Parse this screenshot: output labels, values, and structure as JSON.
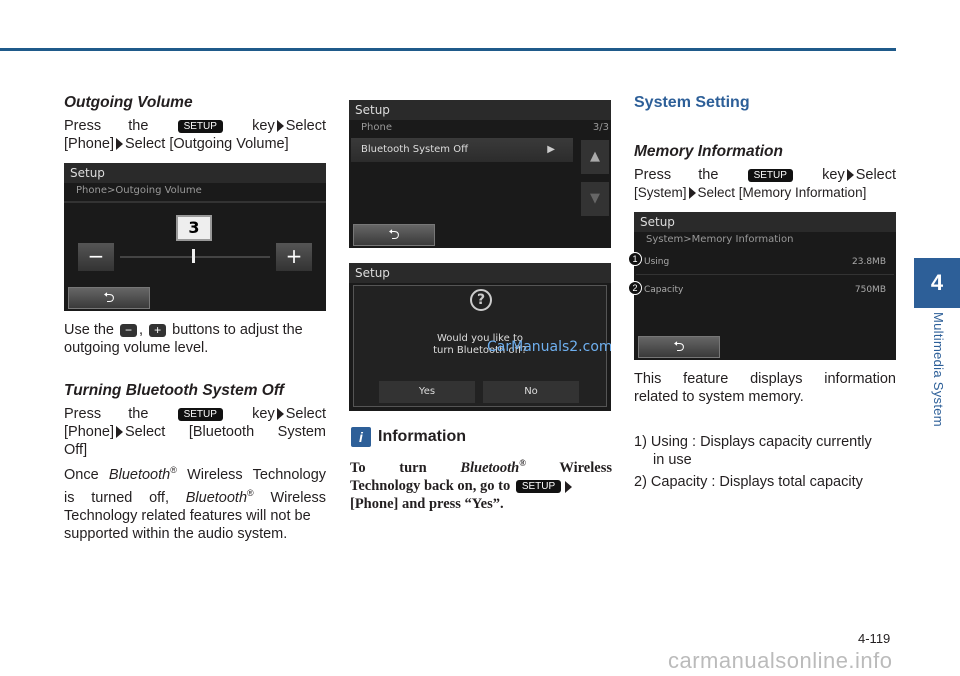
{
  "side": {
    "chapter": "4",
    "label": "Multimedia System"
  },
  "footer": {
    "page": "4-119",
    "watermark": "carmanualsonline.info"
  },
  "col1": {
    "h_outgoing": "Outgoing Volume",
    "press": "Press the",
    "setup": "SETUP",
    "key_select": "key",
    "select": "Select",
    "outgoing_path_a": "[Phone]",
    "outgoing_path_b": "Select [Outgoing Volume]",
    "shot1": {
      "title": "Setup",
      "sub": "Phone>Outgoing Volume",
      "value": "3",
      "minus": "−",
      "plus": "+",
      "back": "⮌"
    },
    "use_a": "Use the",
    "use_comma": ",",
    "use_b": "buttons to adjust the",
    "use_c": "outgoing volume level.",
    "h_bt": "Turning Bluetooth System Off",
    "bt_path_a": "[Phone]",
    "bt_path_b": "Select [Bluetooth System",
    "bt_path_c": "Off]",
    "once_a": "Once",
    "once_bt": "Bluetooth",
    "reg": "®",
    "once_b": "Wireless Technology",
    "once_c": "is turned off,",
    "once_d": "Wireless",
    "once_e": "Technology related features will not be",
    "once_f": "supported within the audio system."
  },
  "col2": {
    "shot2": {
      "title": "Setup",
      "sub": "Phone",
      "page": "3/3",
      "item": "Bluetooth System Off"
    },
    "shot3": {
      "title": "Setup",
      "q": "?",
      "msg1": "Would you like to",
      "msg2": "turn Bluetooth off?",
      "yes": "Yes",
      "no": "No",
      "wm": "CarManuals2.com"
    },
    "info_icon": "i",
    "info_title": "Information",
    "info_a": "To turn",
    "info_bt": "Bluetooth",
    "info_reg": "®",
    "info_b": "Wireless",
    "info_c": "Technology back on, go to",
    "info_d": "[Phone] and press “Yes”.",
    "setup": "SETUP"
  },
  "col3": {
    "h_sys": "System Setting",
    "h_mem": "Memory Information",
    "press": "Press the",
    "setup": "SETUP",
    "key": "key",
    "select": "Select",
    "path_a": "[System]",
    "path_b": "Select [Memory Information]",
    "shot4": {
      "title": "Setup",
      "sub": "System>Memory Information",
      "r1": "Using",
      "v1": "23.8MB",
      "r2": "Capacity",
      "v2": "750MB",
      "c1": "1",
      "c2": "2"
    },
    "desc1": "This feature displays information",
    "desc2": "related to system memory.",
    "li1a": "1) Using : Displays capacity currently",
    "li1b": "in use",
    "li2": "2) Capacity : Displays total capacity"
  }
}
